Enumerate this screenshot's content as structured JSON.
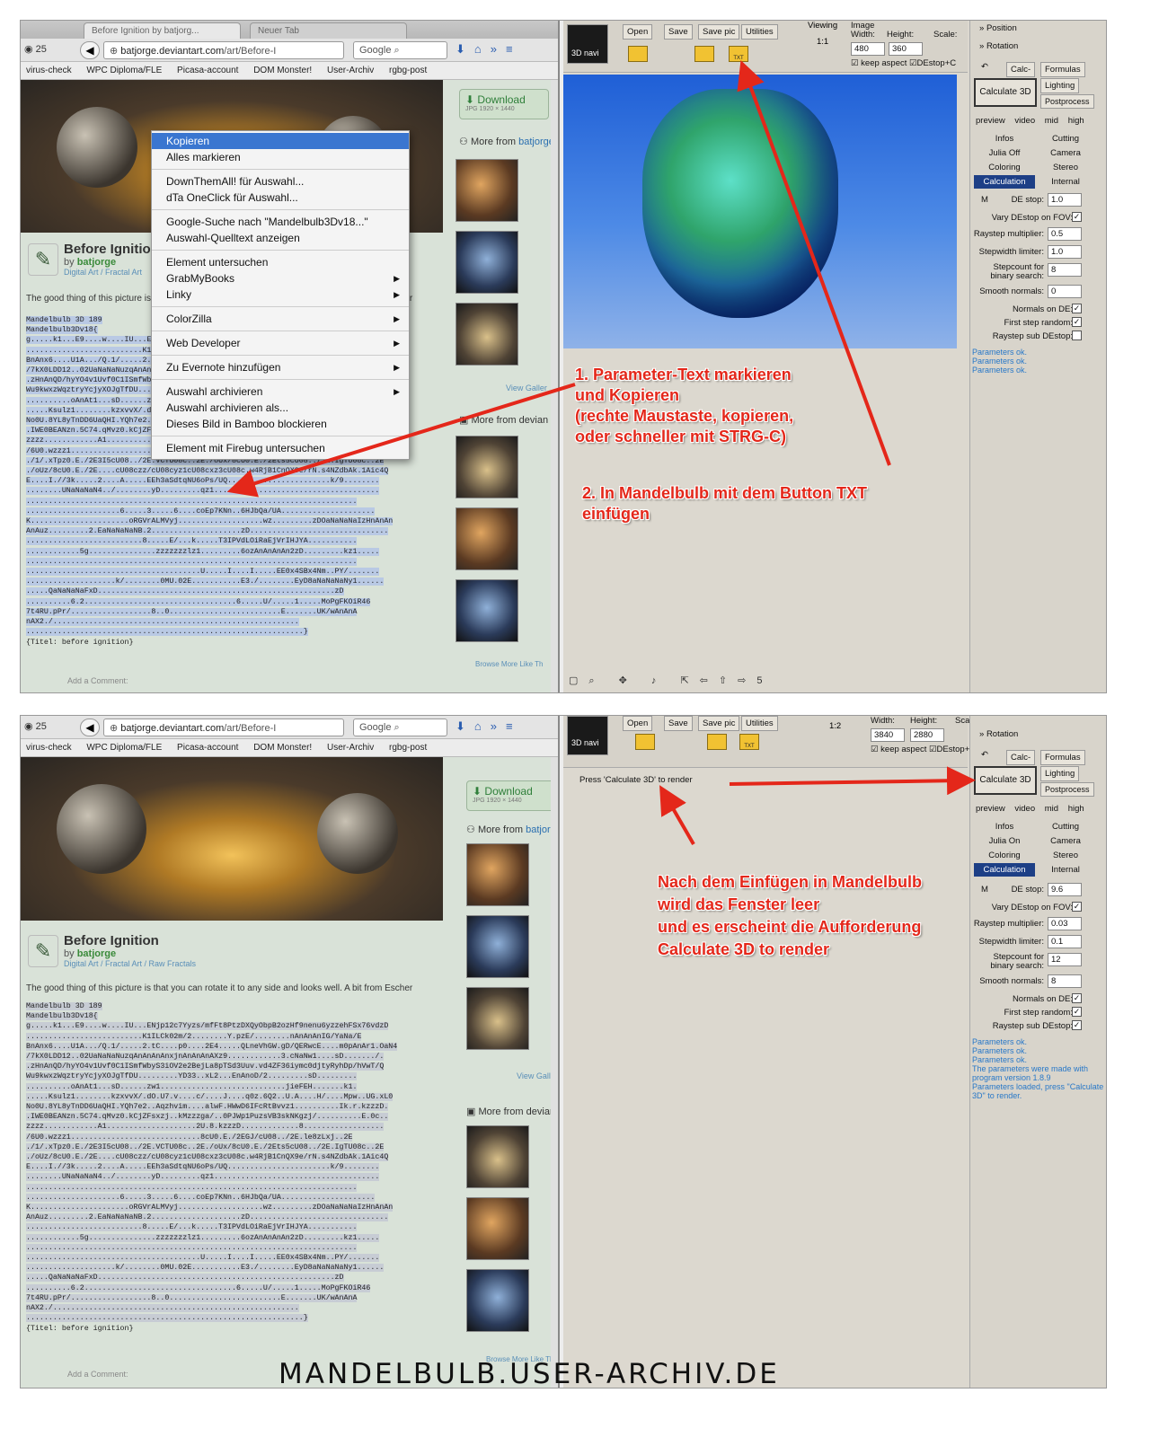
{
  "browser": {
    "tab_active": "Before Ignition by batjorg...",
    "tab_new": "Neuer Tab",
    "rss_count": "25",
    "url_domain": "batjorge.deviantart.com",
    "url_path": "/art/Before-I",
    "search_engine": "Google",
    "bookmarks": [
      "virus-check",
      "WPC Diploma/FLE",
      "Picasa-account",
      "DOM Monster!",
      "User-Archiv",
      "rgbg-post"
    ]
  },
  "deviation": {
    "download_label": "Download",
    "download_size": "JPG 1920 × 1440",
    "more_from_artist": "More from",
    "artist_link": "batjorge",
    "more_from_deviantart": "More from devian",
    "view_gallery": "View Galler",
    "browse_more": "Browse More Like Th",
    "title": "Before Ignition",
    "by": "by",
    "author": "batjorge",
    "category_top": "Digital Art / Fractal Art / Raw Fractals",
    "category_top_cut": "Digital Art / Fractal Art",
    "description": "The good thing of this picture is that you can rotate it to any side and looks well. A bit from Escher",
    "param_header1": "Mandelbulb 3D 189",
    "param_lines": [
      "Mandelbulb3Dv18{",
      "g.....k1...E9....w....IU...ENjp12c7Yyzs/mfFt8PtzDXQyObpB2ozHf9nenu6yzzehFSx76vdzD",
      "..........................K1ILCk02m/2........Y.pzE/........nAnAnAnIG/YaNa/E",
      "BnAnx6....U1A.../Q.1/.....2.tC....p0....2E4.....QLneVhGW.gD/QERwcE....m0pAnAr1.OaN4",
      "/7kX0LDD12..02UaNaNaNuzqAnAnAnAnxjnAnAnAnAXz9............3.cNaNw1....sD......./.",
      ".zHnAnQD/hyYO4v1Uvf0C1ISmfWbyS3iOV2e2BejLa8pTSd3Uuv.vd4ZF36iymc0djtyRyhDp/hVwT/Q",
      "Wu9kwxzWqztryYcjyXOJgTfDU.........YD33..xL2...EnAnoD/2.........sD.........",
      "..........oAnAt1...sD......zw1............................jieFEH.......k1.",
      ".....Ksulz1........kzxvvX/.dO.U7.v....c/....J....q0z.6Q2..U.A....H/....Mpw..UG.xL0",
      "No0U.8YL8yTnDD6UaQHI.YQh7e2..Aqzhvim....alwF.HWwD6IFcRtBvvz1..........Ik.r.kzzzD.",
      ".IWE0BEANzn.5C74.qMvz0.kCjZFsxzj..kMzzzga/..0PJWp1PuzsVB3skNKgzj/..........E.0c..",
      "zzzz............A1....................2U.8.kzzzD.............8..................",
      "/6U0.wzzz1.............................8cU0.E./2EGJ/cU08../2E.le8zLxj..2E",
      "./1/.xTpz0.E./2E3I5cU08../2E.VCTU08c..2E./oUx/8cU0.E./2Ets5cU08../2E.IgTU08c..2E",
      "./oUz/8cU0.E./2E....cU08czz/cU08cyz1cU08cxz3cU08c.w4RjB1CnQX9e/rN.s4NZdbAk.1Aic4Q",
      "E....I.//3k.....2....A.....EEh3aSdtqNU6oPs/UQ.......................k/9........",
      "........UNaNaNaN4../........yD.........qz1.....................................",
      "..........................................................................",
      ".....................6.....3.....6....coEp7KNn..6HJbQa/UA.....................",
      "K......................oRGVrALMVyj...................wz.........zDOaNaNaNaIzHnAnAn",
      "AnAuz.........2.EaNaNaNaNB.2....................zD...............................",
      "..........................8.....E/...k.....T3IPVdLOiRaEjVrIHJYA...........",
      "............5g...............zzzzzzzlz1.........6ozAnAnAnAn2zD.........kz1.....",
      "..........................................................................",
      ".......................................U.....I....I.....EE0x4SBx4Nm..PY/.......",
      "....................k/........0MU.02E...........E3./........EyD8aNaNaNaNy1......",
      ".....QaNaNaNaFxD.....................................................zD",
      "..........6.2..................................6.....U/.....1.....MoPgFKOiR46",
      "7t4RU.pPr/..................8..0.........................E.......UK/wAnAnA",
      "nAX2./.......................................................",
      "..............................................................}"
    ],
    "param_footer": "{Titel: before ignition}",
    "add_comment": "Add a Comment:"
  },
  "context_menu": {
    "items": [
      "Kopieren",
      "Alles markieren",
      "DownThemAll! für Auswahl...",
      "dTa OneClick für Auswahl...",
      "Google-Suche nach \"Mandelbulb3Dv18...\"",
      "Auswahl-Quelltext anzeigen",
      "Element untersuchen",
      "GrabMyBooks",
      "Linky",
      "ColorZilla",
      "Web Developer",
      "Zu Evernote hinzufügen",
      "Auswahl archivieren",
      "Auswahl archivieren als...",
      "Dieses Bild in Bamboo blockieren",
      "Element mit Firebug untersuchen"
    ]
  },
  "mandelbulb": {
    "toolbar": {
      "open": "Open",
      "save": "Save",
      "save_pic": "Save pic",
      "utilities": "Utilities",
      "viewing": "Viewing",
      "viewing_value_1": "1:1",
      "viewing_value_2": "1:2",
      "image": "Image",
      "width_label": "Width:",
      "height_label": "Height:",
      "scale_label": "Scale:",
      "width_1": "480",
      "height_1": "360",
      "width_2": "3840",
      "height_2": "2880",
      "keep_aspect": "keep aspect",
      "destop_c": "DEstop+C",
      "txt_label": "TXT",
      "nav_label": "3D navi"
    },
    "sidebar": {
      "position": "Position",
      "rotation": "Rotation",
      "calc": "Calc-",
      "formulas": "Formulas",
      "lighting": "Lighting",
      "postprocess": "Postprocess",
      "calculate_3d": "Calculate 3D",
      "preview": "preview",
      "video": "video",
      "mid": "mid",
      "high": "high",
      "tabs": [
        "Infos",
        "Cutting",
        "Julia Off",
        "Camera",
        "Coloring",
        "Stereo",
        "Calculation",
        "Internal"
      ],
      "tabs_2": [
        "Infos",
        "Cutting",
        "Julia On",
        "Camera",
        "Coloring",
        "Stereo",
        "Calculation",
        "Internal"
      ],
      "m_label": "M",
      "de_stop_label": "DE stop:",
      "vary_destop_label": "Vary DEstop on FOV:",
      "raystep_label": "Raystep multiplier:",
      "stepwidth_label": "Stepwidth limiter:",
      "stepcount_label": "Stepcount for binary search:",
      "smooth_label": "Smooth normals:",
      "normals_de_label": "Normals on DE:",
      "first_step_label": "First step random:",
      "raystep_sub_label": "Raystep sub DEstop:",
      "values_1": {
        "de_stop": "1.0",
        "raystep": "0.5",
        "stepwidth": "1.0",
        "stepcount": "8",
        "smooth": "0"
      },
      "values_2": {
        "de_stop": "9.6",
        "raystep": "0.03",
        "stepwidth": "0.1",
        "stepcount": "12",
        "smooth": "8"
      },
      "log_1": [
        "Parameters ok.",
        "Parameters ok.",
        "Parameters ok."
      ],
      "log_2": [
        "Parameters ok.",
        "Parameters ok.",
        "Parameters ok.",
        "The parameters were made with program version 1.8.9",
        "Parameters loaded, press \"Calculate 3D\" to render."
      ]
    },
    "status_press": "Press 'Calculate 3D' to render",
    "bottom_value": "5"
  },
  "annotations": {
    "step1": [
      "1. Parameter-Text markieren",
      "und Kopieren",
      "(rechte Maustaste, kopieren,",
      "oder schneller mit STRG-C)"
    ],
    "step2": [
      "2. In Mandelbulb mit dem Button TXT",
      "einfügen"
    ],
    "step3": [
      "Nach dem Einfügen in Mandelbulb",
      "wird das Fenster leer",
      "und es erscheint die Aufforderung",
      "Calculate 3D to render"
    ],
    "arrow_color": "#e4271a"
  },
  "footer": "MANDELBULB.USER-ARCHIV.DE"
}
